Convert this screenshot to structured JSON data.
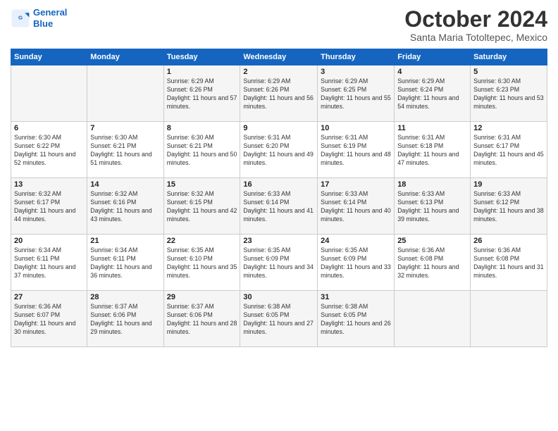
{
  "header": {
    "logo_line1": "General",
    "logo_line2": "Blue",
    "month": "October 2024",
    "location": "Santa Maria Totoltepec, Mexico"
  },
  "days_of_week": [
    "Sunday",
    "Monday",
    "Tuesday",
    "Wednesday",
    "Thursday",
    "Friday",
    "Saturday"
  ],
  "weeks": [
    [
      {
        "day": "",
        "info": ""
      },
      {
        "day": "",
        "info": ""
      },
      {
        "day": "1",
        "info": "Sunrise: 6:29 AM\nSunset: 6:26 PM\nDaylight: 11 hours and 57 minutes."
      },
      {
        "day": "2",
        "info": "Sunrise: 6:29 AM\nSunset: 6:26 PM\nDaylight: 11 hours and 56 minutes."
      },
      {
        "day": "3",
        "info": "Sunrise: 6:29 AM\nSunset: 6:25 PM\nDaylight: 11 hours and 55 minutes."
      },
      {
        "day": "4",
        "info": "Sunrise: 6:29 AM\nSunset: 6:24 PM\nDaylight: 11 hours and 54 minutes."
      },
      {
        "day": "5",
        "info": "Sunrise: 6:30 AM\nSunset: 6:23 PM\nDaylight: 11 hours and 53 minutes."
      }
    ],
    [
      {
        "day": "6",
        "info": "Sunrise: 6:30 AM\nSunset: 6:22 PM\nDaylight: 11 hours and 52 minutes."
      },
      {
        "day": "7",
        "info": "Sunrise: 6:30 AM\nSunset: 6:21 PM\nDaylight: 11 hours and 51 minutes."
      },
      {
        "day": "8",
        "info": "Sunrise: 6:30 AM\nSunset: 6:21 PM\nDaylight: 11 hours and 50 minutes."
      },
      {
        "day": "9",
        "info": "Sunrise: 6:31 AM\nSunset: 6:20 PM\nDaylight: 11 hours and 49 minutes."
      },
      {
        "day": "10",
        "info": "Sunrise: 6:31 AM\nSunset: 6:19 PM\nDaylight: 11 hours and 48 minutes."
      },
      {
        "day": "11",
        "info": "Sunrise: 6:31 AM\nSunset: 6:18 PM\nDaylight: 11 hours and 47 minutes."
      },
      {
        "day": "12",
        "info": "Sunrise: 6:31 AM\nSunset: 6:17 PM\nDaylight: 11 hours and 45 minutes."
      }
    ],
    [
      {
        "day": "13",
        "info": "Sunrise: 6:32 AM\nSunset: 6:17 PM\nDaylight: 11 hours and 44 minutes."
      },
      {
        "day": "14",
        "info": "Sunrise: 6:32 AM\nSunset: 6:16 PM\nDaylight: 11 hours and 43 minutes."
      },
      {
        "day": "15",
        "info": "Sunrise: 6:32 AM\nSunset: 6:15 PM\nDaylight: 11 hours and 42 minutes."
      },
      {
        "day": "16",
        "info": "Sunrise: 6:33 AM\nSunset: 6:14 PM\nDaylight: 11 hours and 41 minutes."
      },
      {
        "day": "17",
        "info": "Sunrise: 6:33 AM\nSunset: 6:14 PM\nDaylight: 11 hours and 40 minutes."
      },
      {
        "day": "18",
        "info": "Sunrise: 6:33 AM\nSunset: 6:13 PM\nDaylight: 11 hours and 39 minutes."
      },
      {
        "day": "19",
        "info": "Sunrise: 6:33 AM\nSunset: 6:12 PM\nDaylight: 11 hours and 38 minutes."
      }
    ],
    [
      {
        "day": "20",
        "info": "Sunrise: 6:34 AM\nSunset: 6:11 PM\nDaylight: 11 hours and 37 minutes."
      },
      {
        "day": "21",
        "info": "Sunrise: 6:34 AM\nSunset: 6:11 PM\nDaylight: 11 hours and 36 minutes."
      },
      {
        "day": "22",
        "info": "Sunrise: 6:35 AM\nSunset: 6:10 PM\nDaylight: 11 hours and 35 minutes."
      },
      {
        "day": "23",
        "info": "Sunrise: 6:35 AM\nSunset: 6:09 PM\nDaylight: 11 hours and 34 minutes."
      },
      {
        "day": "24",
        "info": "Sunrise: 6:35 AM\nSunset: 6:09 PM\nDaylight: 11 hours and 33 minutes."
      },
      {
        "day": "25",
        "info": "Sunrise: 6:36 AM\nSunset: 6:08 PM\nDaylight: 11 hours and 32 minutes."
      },
      {
        "day": "26",
        "info": "Sunrise: 6:36 AM\nSunset: 6:08 PM\nDaylight: 11 hours and 31 minutes."
      }
    ],
    [
      {
        "day": "27",
        "info": "Sunrise: 6:36 AM\nSunset: 6:07 PM\nDaylight: 11 hours and 30 minutes."
      },
      {
        "day": "28",
        "info": "Sunrise: 6:37 AM\nSunset: 6:06 PM\nDaylight: 11 hours and 29 minutes."
      },
      {
        "day": "29",
        "info": "Sunrise: 6:37 AM\nSunset: 6:06 PM\nDaylight: 11 hours and 28 minutes."
      },
      {
        "day": "30",
        "info": "Sunrise: 6:38 AM\nSunset: 6:05 PM\nDaylight: 11 hours and 27 minutes."
      },
      {
        "day": "31",
        "info": "Sunrise: 6:38 AM\nSunset: 6:05 PM\nDaylight: 11 hours and 26 minutes."
      },
      {
        "day": "",
        "info": ""
      },
      {
        "day": "",
        "info": ""
      }
    ]
  ]
}
